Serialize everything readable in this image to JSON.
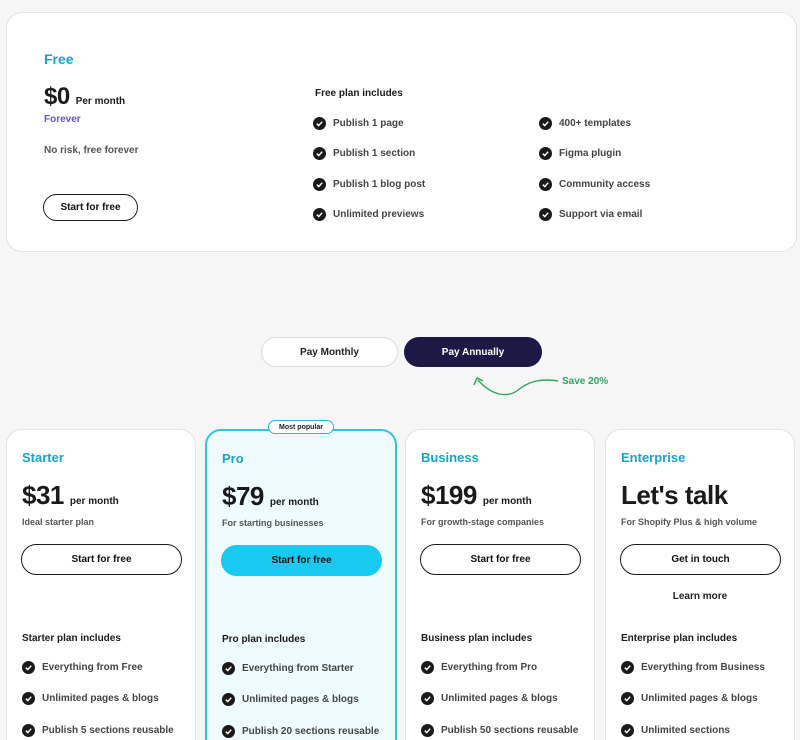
{
  "free": {
    "title": "Free",
    "price": "$0",
    "period": "Per month",
    "forever": "Forever",
    "desc": "No risk, free forever",
    "button": "Start for free",
    "includes_title": "Free plan includes",
    "features_left": [
      "Publish 1 page",
      "Publish 1 section",
      "Publish 1 blog post",
      "Unlimited previews"
    ],
    "features_right": [
      "400+ templates",
      "Figma plugin",
      "Community access",
      "Support via email"
    ]
  },
  "billing": {
    "monthly": "Pay Monthly",
    "annually": "Pay Annually",
    "save": "Save 20%"
  },
  "badge": "Most popular",
  "plans": [
    {
      "name": "Starter",
      "price": "$31",
      "period": "per month",
      "sub": "Ideal starter plan",
      "button": "Start for free",
      "includes_title": "Starter plan includes",
      "features": [
        "Everything from Free",
        "Unlimited pages & blogs",
        "Publish 5 sections reusable"
      ]
    },
    {
      "name": "Pro",
      "price": "$79",
      "period": "per month",
      "sub": "For starting businesses",
      "button": "Start for free",
      "includes_title": "Pro plan includes",
      "features": [
        "Everything from Starter",
        "Unlimited pages & blogs",
        "Publish 20 sections reusable"
      ]
    },
    {
      "name": "Business",
      "price": "$199",
      "period": "per month",
      "sub": "For growth-stage companies",
      "button": "Start for free",
      "includes_title": "Business plan includes",
      "features": [
        "Everything from Pro",
        "Unlimited pages & blogs",
        "Publish 50 sections reusable"
      ]
    },
    {
      "name": "Enterprise",
      "price": "Let's talk",
      "period": "",
      "sub": "For Shopify Plus & high volume",
      "button": "Get in touch",
      "learn_more": "Learn more",
      "includes_title": "Enterprise plan includes",
      "features": [
        "Everything from Business",
        "Unlimited pages & blogs",
        "Unlimited sections"
      ]
    }
  ],
  "colors": {
    "accent": "#1aa3c7",
    "cta_cyan": "#19c9ee",
    "toggle_dark": "#1c1a45",
    "save_green": "#2fa65f",
    "forever_purple": "#6b4fd8"
  }
}
